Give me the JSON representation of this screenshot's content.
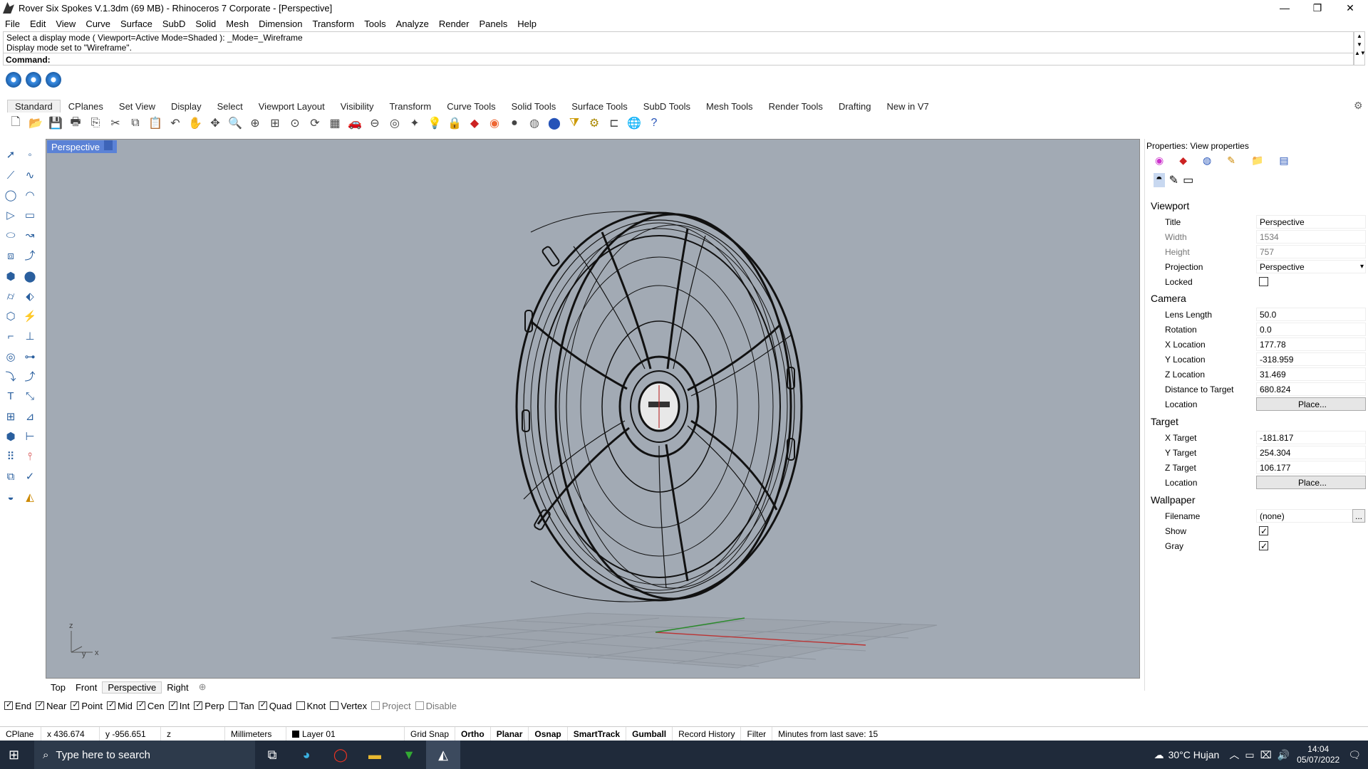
{
  "window": {
    "title": "Rover Six Spokes V.1.3dm (69 MB) - Rhinoceros 7 Corporate - [Perspective]",
    "minimize": "—",
    "restore": "❐",
    "close": "✕"
  },
  "menu": [
    "File",
    "Edit",
    "View",
    "Curve",
    "Surface",
    "SubD",
    "Solid",
    "Mesh",
    "Dimension",
    "Transform",
    "Tools",
    "Analyze",
    "Render",
    "Panels",
    "Help"
  ],
  "command": {
    "history_line1": "Select a display mode ( Viewport=Active  Mode=Shaded ): _Mode=_Wireframe",
    "history_line2": "Display mode set to \"Wireframe\".",
    "prompt": "Command:"
  },
  "tabs": [
    "Standard",
    "CPlanes",
    "Set View",
    "Display",
    "Select",
    "Viewport Layout",
    "Visibility",
    "Transform",
    "Curve Tools",
    "Solid Tools",
    "Surface Tools",
    "SubD Tools",
    "Mesh Tools",
    "Render Tools",
    "Drafting",
    "New in V7"
  ],
  "viewport": {
    "title": "Perspective",
    "axis_z": "z",
    "axis_y": "y",
    "axis_x": "x"
  },
  "properties": {
    "header": "Properties: View properties",
    "sections": {
      "viewport": "Viewport",
      "camera": "Camera",
      "target": "Target",
      "wallpaper": "Wallpaper"
    },
    "title_label": "Title",
    "title_value": "Perspective",
    "width_label": "Width",
    "width_value": "1534",
    "height_label": "Height",
    "height_value": "757",
    "projection_label": "Projection",
    "projection_value": "Perspective",
    "locked_label": "Locked",
    "lens_label": "Lens Length",
    "lens_value": "50.0",
    "rotation_label": "Rotation",
    "rotation_value": "0.0",
    "xloc_label": "X Location",
    "xloc_value": "177.78",
    "yloc_label": "Y Location",
    "yloc_value": "-318.959",
    "zloc_label": "Z Location",
    "zloc_value": "31.469",
    "dist_label": "Distance to Target",
    "dist_value": "680.824",
    "cam_location_label": "Location",
    "place_button": "Place...",
    "xtarget_label": "X Target",
    "xtarget_value": "-181.817",
    "ytarget_label": "Y Target",
    "ytarget_value": "254.304",
    "ztarget_label": "Z Target",
    "ztarget_value": "106.177",
    "tgt_location_label": "Location",
    "filename_label": "Filename",
    "filename_value": "(none)",
    "filename_browse": "...",
    "show_label": "Show",
    "gray_label": "Gray"
  },
  "viewtabs": [
    "Top",
    "Front",
    "Perspective",
    "Right"
  ],
  "viewtab_add": "⊕",
  "osnaps": [
    {
      "label": "End",
      "on": true
    },
    {
      "label": "Near",
      "on": true
    },
    {
      "label": "Point",
      "on": true
    },
    {
      "label": "Mid",
      "on": true
    },
    {
      "label": "Cen",
      "on": true
    },
    {
      "label": "Int",
      "on": true
    },
    {
      "label": "Perp",
      "on": true
    },
    {
      "label": "Tan",
      "on": false
    },
    {
      "label": "Quad",
      "on": true
    },
    {
      "label": "Knot",
      "on": false
    },
    {
      "label": "Vertex",
      "on": false
    },
    {
      "label": "Project",
      "on": false,
      "disabled": true
    },
    {
      "label": "Disable",
      "on": false,
      "disabled": true
    }
  ],
  "status": {
    "cplane": "CPlane",
    "x": "x 436.674",
    "y": "y -956.651",
    "z": "z",
    "units": "Millimeters",
    "layer": "Layer 01",
    "grid_snap": "Grid Snap",
    "ortho": "Ortho",
    "planar": "Planar",
    "osnap": "Osnap",
    "smarttrack": "SmartTrack",
    "gumball": "Gumball",
    "record_history": "Record History",
    "filter": "Filter",
    "last_save": "Minutes from last save: 15"
  },
  "taskbar": {
    "search_placeholder": "Type here to search",
    "weather": "30°C  Hujan",
    "time": "14:04",
    "date": "05/07/2022"
  }
}
